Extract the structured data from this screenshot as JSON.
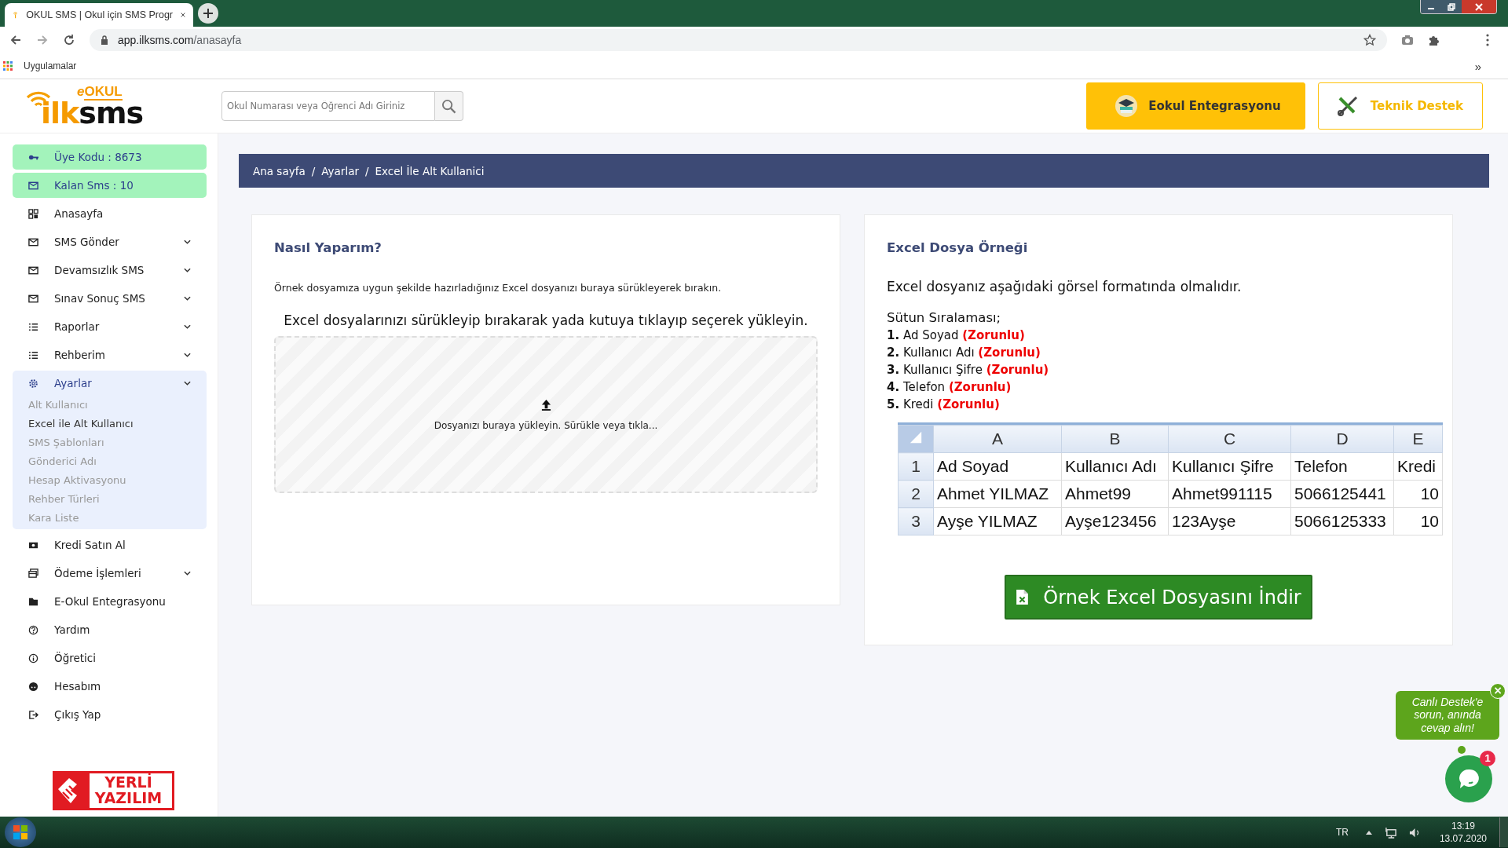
{
  "browser": {
    "tab_title": "OKUL SMS | Okul için SMS Progr",
    "url_host": "app.ilksms.com",
    "url_path": "/anasayfa",
    "bookmarks_label": "Uygulamalar",
    "bookmarks_more": "»"
  },
  "logo": {
    "top_prefix": "e",
    "top": "OKUL",
    "bottom_prefix": "ilk",
    "bottom": "sms"
  },
  "search": {
    "placeholder": "Okul Numarası veya Öğrenci Adı Giriniz"
  },
  "header_buttons": [
    {
      "label": "Eokul Entegrasyonu",
      "kind": "primary"
    },
    {
      "label": "Teknik Destek",
      "kind": "outline"
    }
  ],
  "sidebar": {
    "items": [
      {
        "label": "Üye Kodu : 8673",
        "kind": "badge"
      },
      {
        "label": "Kalan Sms : 10",
        "kind": "badge"
      },
      {
        "label": "Anasayfa",
        "kind": "link",
        "selected": false
      },
      {
        "label": "SMS Gönder",
        "kind": "menu",
        "selected": false
      },
      {
        "label": "Devamsızlık SMS",
        "kind": "menu",
        "selected": false
      },
      {
        "label": "Sınav Sonuç SMS",
        "kind": "menu",
        "selected": false
      },
      {
        "label": "Raporlar",
        "kind": "menu",
        "selected": false
      },
      {
        "label": "Rehberim",
        "kind": "menu",
        "selected": false
      },
      {
        "label": "Ayarlar",
        "kind": "menu",
        "selected": true,
        "expanded": true,
        "children": [
          {
            "label": "Alt Kullanıcı",
            "selected": false
          },
          {
            "label": "Excel ile Alt Kullanıcı",
            "selected": true
          },
          {
            "label": "SMS Şablonları",
            "selected": false
          },
          {
            "label": "Gönderici Adı",
            "selected": false
          },
          {
            "label": "Hesap Aktivasyonu",
            "selected": false
          },
          {
            "label": "Rehber Türleri",
            "selected": false
          },
          {
            "label": "Kara Liste",
            "selected": false
          }
        ]
      },
      {
        "label": "Kredi Satın Al",
        "kind": "link",
        "selected": false
      },
      {
        "label": "Ödeme İşlemleri",
        "kind": "menu",
        "selected": false
      },
      {
        "label": "E-Okul Entegrasyonu",
        "kind": "link",
        "selected": false
      },
      {
        "label": "Yardım",
        "kind": "link",
        "selected": false
      },
      {
        "label": "Öğretici",
        "kind": "link",
        "selected": false
      },
      {
        "label": "Hesabım",
        "kind": "link",
        "selected": false
      },
      {
        "label": "Çıkış Yap",
        "kind": "link",
        "selected": false
      }
    ],
    "badge": {
      "line1": "YERLİ",
      "line2": "YAZILIM"
    }
  },
  "breadcrumb": [
    "Ana sayfa",
    "Ayarlar",
    "Excel İle Alt Kullanici"
  ],
  "breadcrumb_separator": "/",
  "how_to": {
    "title": "Nasıl Yaparım?",
    "description": "Örnek dosyamıza uygun şekilde hazırladığınız Excel dosyanızı buraya sürükleyerek bırakın.",
    "upload_heading": "Excel dosyalarınızı sürükleyip bırakarak yada kutuya tıklayıp seçerek yükleyin.",
    "dropzone_text": "Dosyanızı buraya yükleyin. Sürükle veya tıkla..."
  },
  "example": {
    "title": "Excel Dosya Örneği",
    "intro": "Excel dosyanız aşağıdaki görsel formatında olmalıdır.",
    "order_heading": "Sütun Sıralaması;",
    "columns_required": [
      {
        "number": "1.",
        "label": "Ad Soyad",
        "note": "(Zorunlu)"
      },
      {
        "number": "2.",
        "label": "Kullanıcı Adı",
        "note": "(Zorunlu)"
      },
      {
        "number": "3.",
        "label": "Kullanıcı Şifre",
        "note": "(Zorunlu)"
      },
      {
        "number": "4.",
        "label": "Telefon",
        "note": "(Zorunlu)"
      },
      {
        "number": "5.",
        "label": "Kredi",
        "note": "(Zorunlu)"
      }
    ],
    "spreadsheet": {
      "columns": [
        "A",
        "B",
        "C",
        "D",
        "E"
      ],
      "rows": [
        {
          "number": "1",
          "cells": [
            "Ad Soyad",
            "Kullanıcı Adı",
            "Kullanıcı Şifre",
            "Telefon",
            "Kredi"
          ]
        },
        {
          "number": "2",
          "cells": [
            "Ahmet YILMAZ",
            "Ahmet99",
            "Ahmet991115",
            "5066125441",
            "10"
          ]
        },
        {
          "number": "3",
          "cells": [
            "Ayşe YILMAZ",
            "Ayşe123456",
            "123Ayşe",
            "5066125333",
            "10"
          ]
        }
      ]
    },
    "download_button": "Örnek Excel Dosyasını İndir"
  },
  "chat": {
    "bubble": "Canlı Destek'e sorun, anında cevap alın!",
    "close": "×",
    "unread": "1"
  },
  "taskbar": {
    "language": "TR",
    "time": "13:19",
    "date": "13.07.2020"
  }
}
